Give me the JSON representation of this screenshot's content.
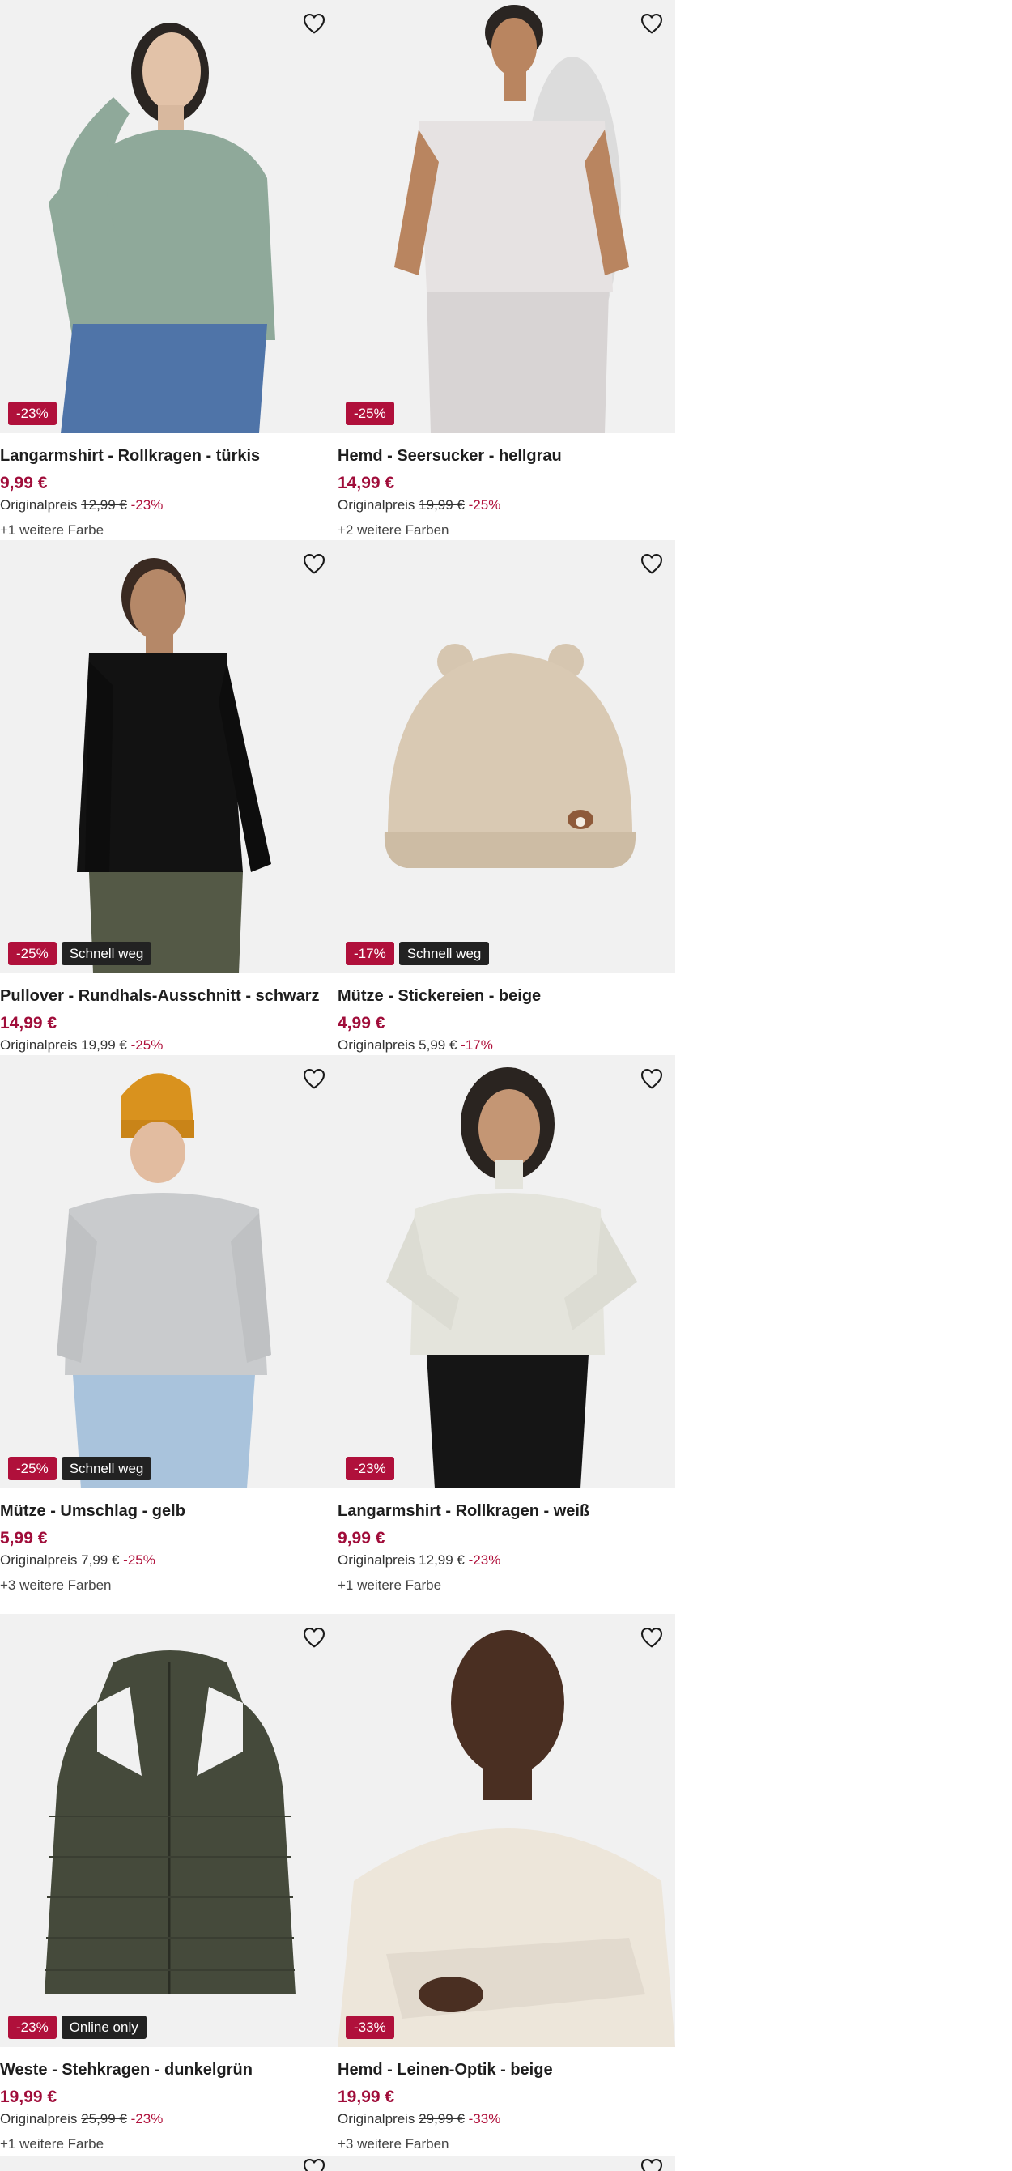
{
  "colors": {
    "discount_badge": "#b0103b",
    "label_badge": "#222222",
    "price": "#a00d3a",
    "image_bg": "#f1f1f1"
  },
  "products": [
    {
      "title": "Langarmshirt - Rollkragen - türkis",
      "price": "9,99 €",
      "orig_label": "Originalpreis",
      "orig_price": "12,99 €",
      "discount": "-23%",
      "badge_discount": "-23%",
      "badge_label": "",
      "more_colors": "+1 weitere Farbe",
      "favorite_icon": "heart-outline-icon"
    },
    {
      "title": "Hemd - Seersucker - hellgrau",
      "price": "14,99 €",
      "orig_label": "Originalpreis",
      "orig_price": "19,99 €",
      "discount": "-25%",
      "badge_discount": "-25%",
      "badge_label": "",
      "more_colors": "+2 weitere Farben",
      "favorite_icon": "heart-outline-icon"
    },
    {
      "title": "Pullover - Rundhals-Ausschnitt - schwarz",
      "price": "14,99 €",
      "orig_label": "Originalpreis",
      "orig_price": "19,99 €",
      "discount": "-25%",
      "badge_discount": "-25%",
      "badge_label": "Schnell weg",
      "more_colors": "",
      "favorite_icon": "heart-outline-icon"
    },
    {
      "title": "Mütze - Stickereien - beige",
      "price": "4,99 €",
      "orig_label": "Originalpreis",
      "orig_price": "5,99 €",
      "discount": "-17%",
      "badge_discount": "-17%",
      "badge_label": "Schnell weg",
      "more_colors": "",
      "favorite_icon": "heart-outline-icon"
    },
    {
      "title": "Mütze - Umschlag - gelb",
      "price": "5,99 €",
      "orig_label": "Originalpreis",
      "orig_price": "7,99 €",
      "discount": "-25%",
      "badge_discount": "-25%",
      "badge_label": "Schnell weg",
      "more_colors": "+3 weitere Farben",
      "favorite_icon": "heart-outline-icon"
    },
    {
      "title": "Langarmshirt - Rollkragen - weiß",
      "price": "9,99 €",
      "orig_label": "Originalpreis",
      "orig_price": "12,99 €",
      "discount": "-23%",
      "badge_discount": "-23%",
      "badge_label": "",
      "more_colors": "+1 weitere Farbe",
      "favorite_icon": "heart-outline-icon"
    },
    {
      "title": "Weste - Stehkragen - dunkelgrün",
      "price": "19,99 €",
      "orig_label": "Originalpreis",
      "orig_price": "25,99 €",
      "discount": "-23%",
      "badge_discount": "-23%",
      "badge_label": "Online only",
      "more_colors": "+1 weitere Farbe",
      "favorite_icon": "heart-outline-icon"
    },
    {
      "title": "Hemd - Leinen-Optik - beige",
      "price": "19,99 €",
      "orig_label": "Originalpreis",
      "orig_price": "29,99 €",
      "discount": "-33%",
      "badge_discount": "-33%",
      "badge_label": "",
      "more_colors": "+3 weitere Farben",
      "favorite_icon": "heart-outline-icon"
    }
  ]
}
